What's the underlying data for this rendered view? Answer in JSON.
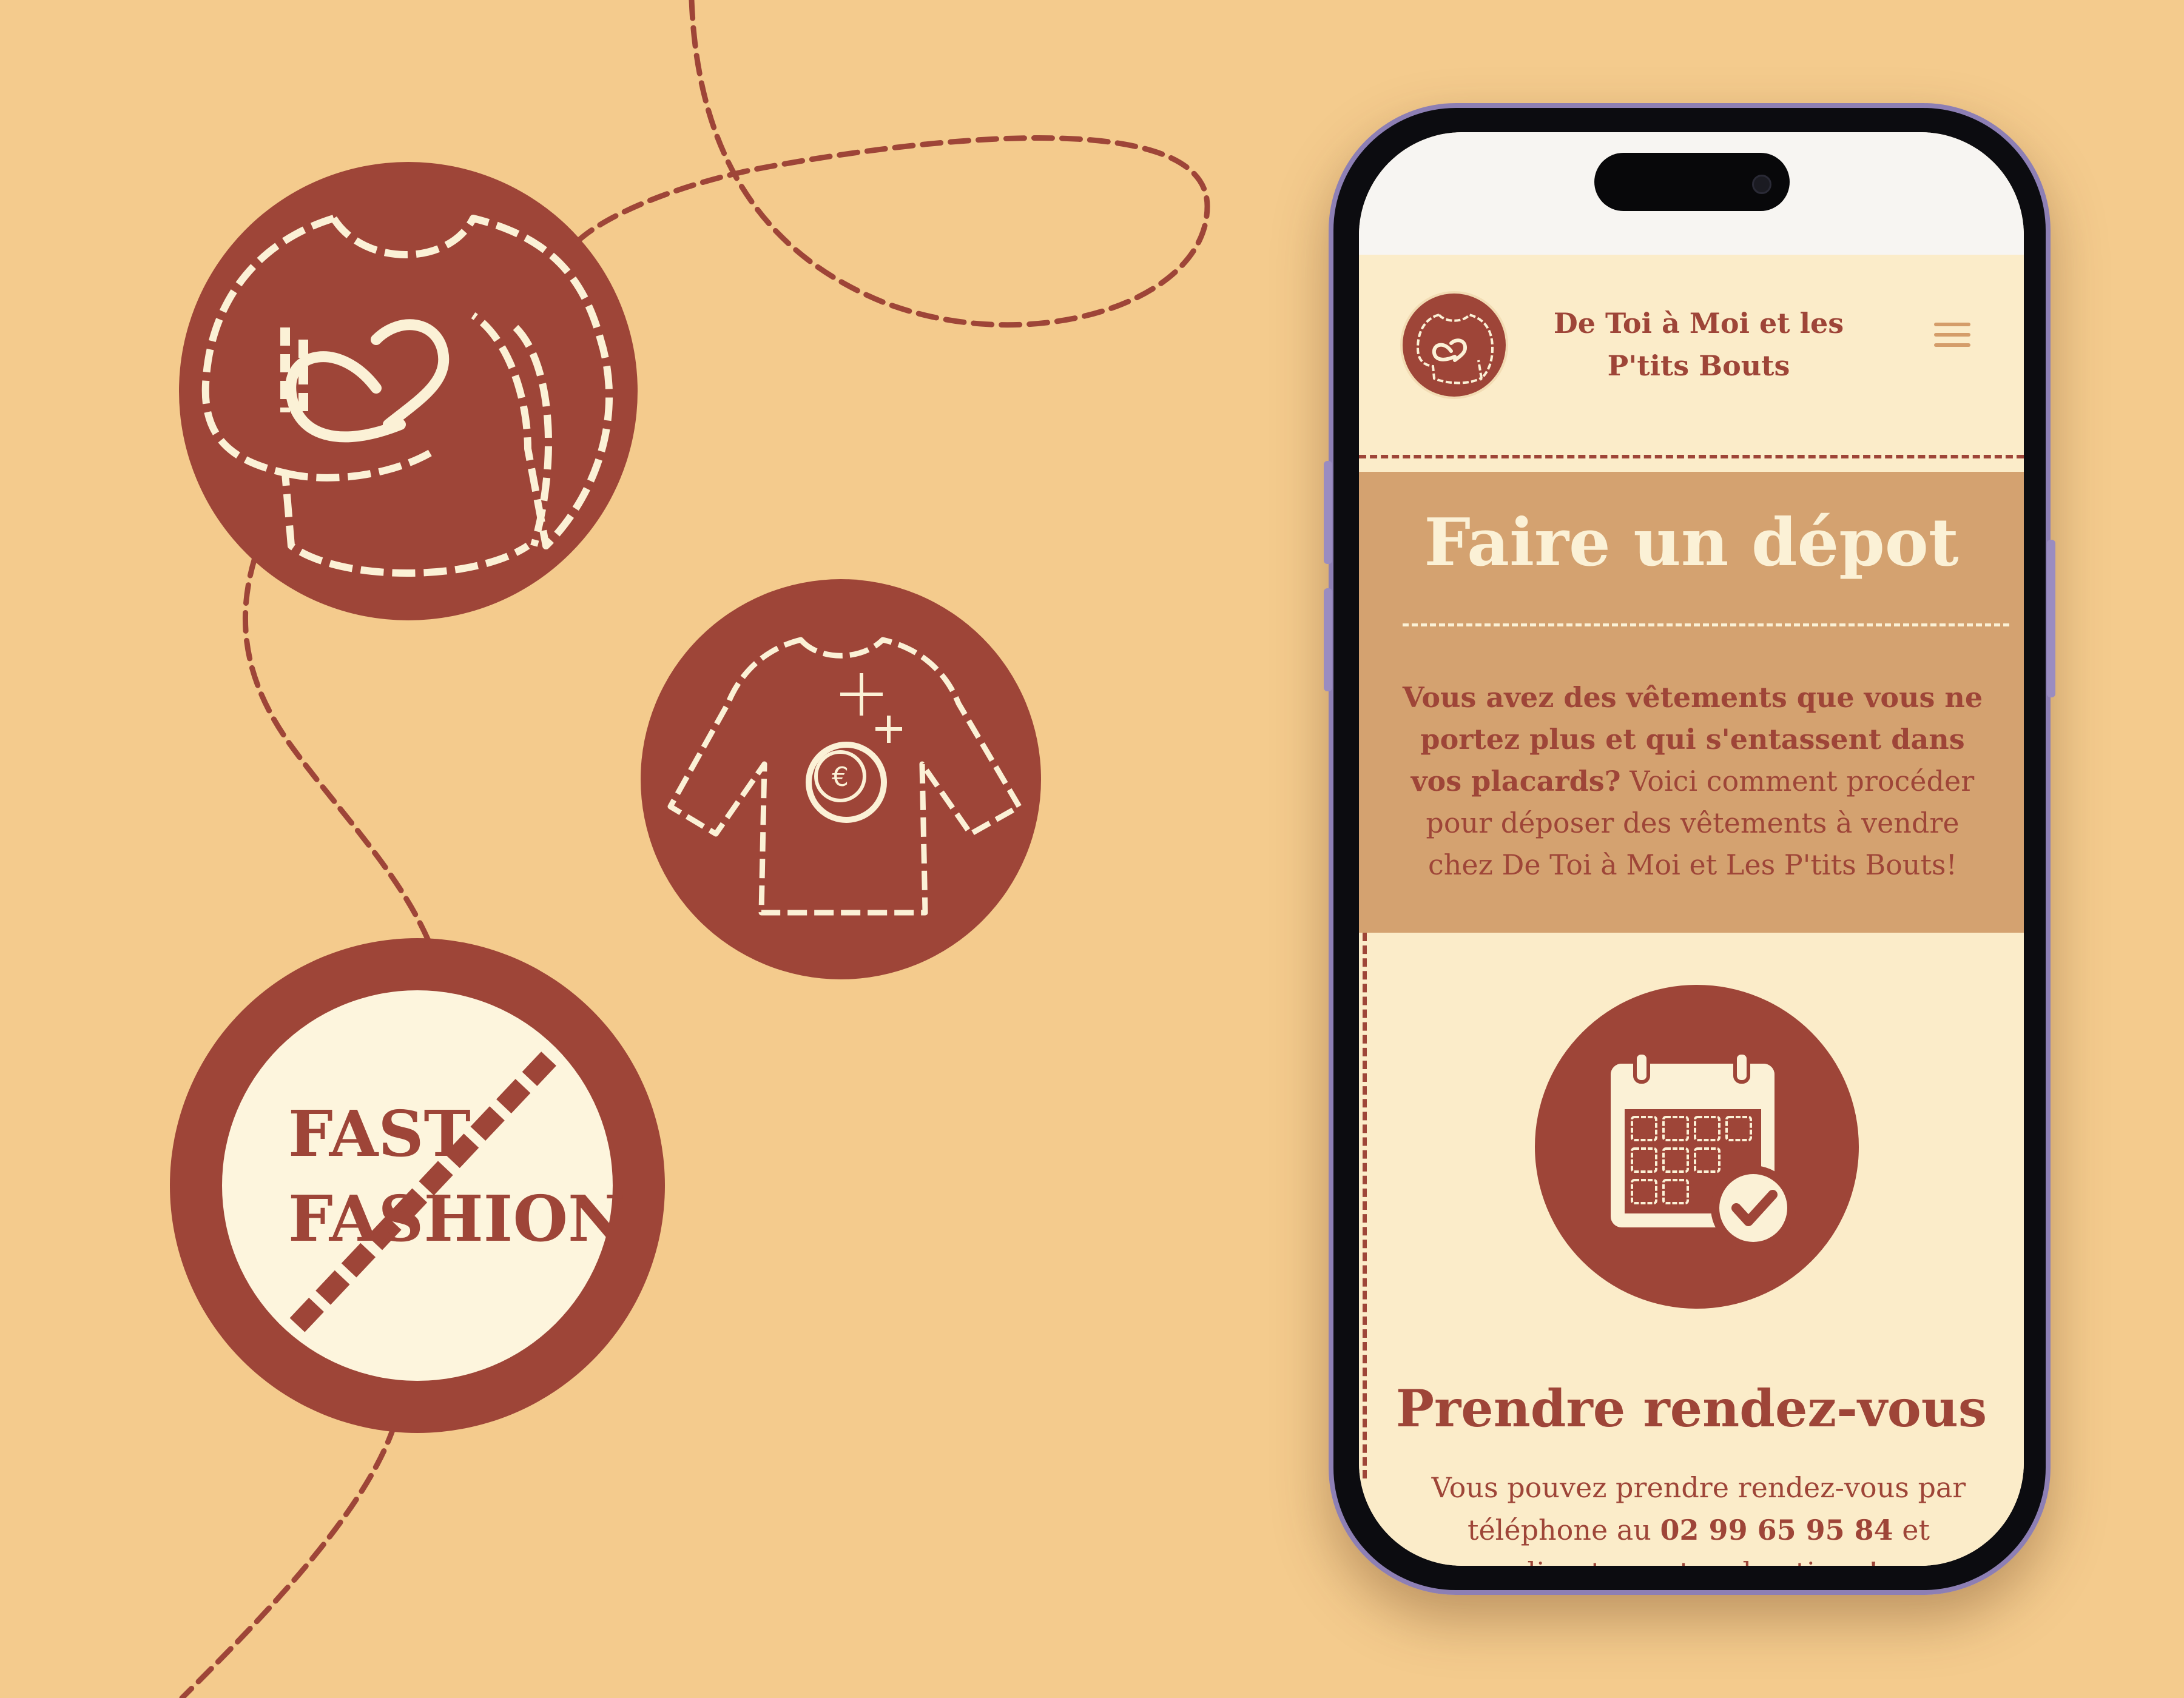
{
  "colors": {
    "background": "#f4cb8d",
    "brand_red": "#9e4538",
    "cream": "#fbecc9",
    "tan": "#d4a270"
  },
  "left_icons": {
    "sweater_heart": "sweater-heart-icon",
    "sweater_euro": "sweater-euro-icon",
    "sweater_euro_symbol": "€",
    "no_fast_fashion": "no-fast-fashion-icon",
    "fast_fashion_line1": "FAST",
    "fast_fashion_line2": "FASHION"
  },
  "site": {
    "logo_icon": "sweater-heart-icon",
    "title": "De Toi à Moi et les P'tits Bouts",
    "menu_icon": "hamburger-menu-icon"
  },
  "hero": {
    "title": "Faire un dépot",
    "text_bold": "Vous avez des vêtements que vous ne portez plus et qui s'entassent dans vos placards?",
    "text_regular": "Voici comment procéder pour déposer des vêtements à vendre chez De Toi à Moi et Les P'tits Bouts!"
  },
  "appointment": {
    "icon": "calendar-check-icon",
    "title": "Prendre rendez-vous",
    "text_before": "Vous pouvez prendre rendez-vous par téléphone au ",
    "phone": "02 99 65 95 84",
    "text_after": " et directement en boutique!"
  }
}
